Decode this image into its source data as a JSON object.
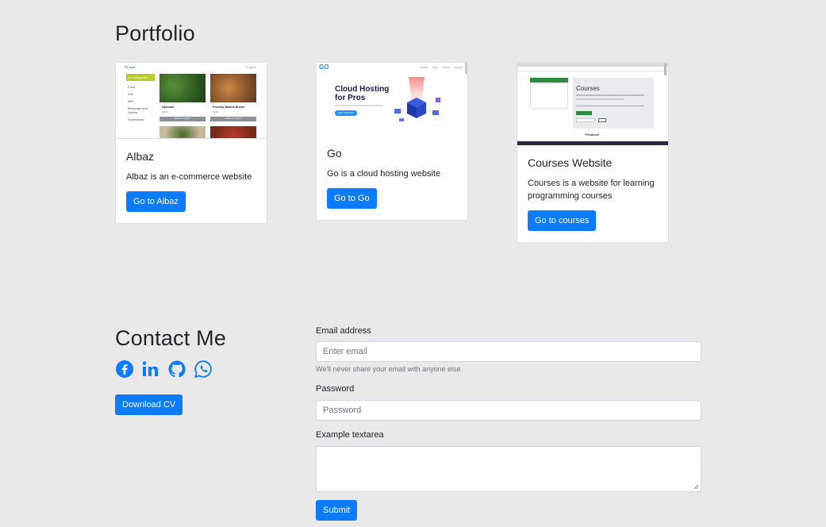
{
  "portfolio": {
    "title": "Portfolio",
    "cards": [
      {
        "title": "Albaz",
        "text": "Albaz is an e-commerce website",
        "button": "Go to Albaz",
        "thumb": {
          "sidebar_active": "All Categories",
          "sidebar_items": [
            "Food",
            "Diet",
            "Milk",
            "Beverage and Spices",
            "Vegetables"
          ],
          "products": [
            "Spinach",
            "Freshly Baked Bread"
          ],
          "prices": [
            "$2.50",
            "$3.00"
          ],
          "cta": "ADD TO CART",
          "lang": "English"
        }
      },
      {
        "title": "Go",
        "text": "Go is a cloud hosting website",
        "button": "Go to Go",
        "thumb": {
          "logo": "GO",
          "headline": "Cloud Hosting for Pros",
          "cta": "GET STARTED",
          "nav": [
            "Hosting",
            "Blog",
            "Pricing",
            "Contact"
          ]
        }
      },
      {
        "title": "Courses Website",
        "text": "Courses is a website for learning programming courses",
        "button": "Go to courses",
        "thumb": {
          "heading": "Courses",
          "section": "Products"
        }
      }
    ]
  },
  "contact": {
    "title": "Contact Me",
    "download_cv": "Download CV",
    "icons": [
      "facebook-icon",
      "linkedin-icon",
      "github-icon",
      "whatsapp-icon"
    ],
    "email_label": "Email address",
    "email_placeholder": "Enter email",
    "email_help": "We'll never share your email with anyone else.",
    "password_label": "Password",
    "password_placeholder": "Password",
    "textarea_label": "Example textarea",
    "submit": "Submit"
  },
  "colors": {
    "accent": "#0d7bfe",
    "background": "#e9e9ea",
    "albaz_green": "#b9cc2a",
    "courses_green": "#2e8b3e",
    "go_blue": "#1e90ff"
  }
}
